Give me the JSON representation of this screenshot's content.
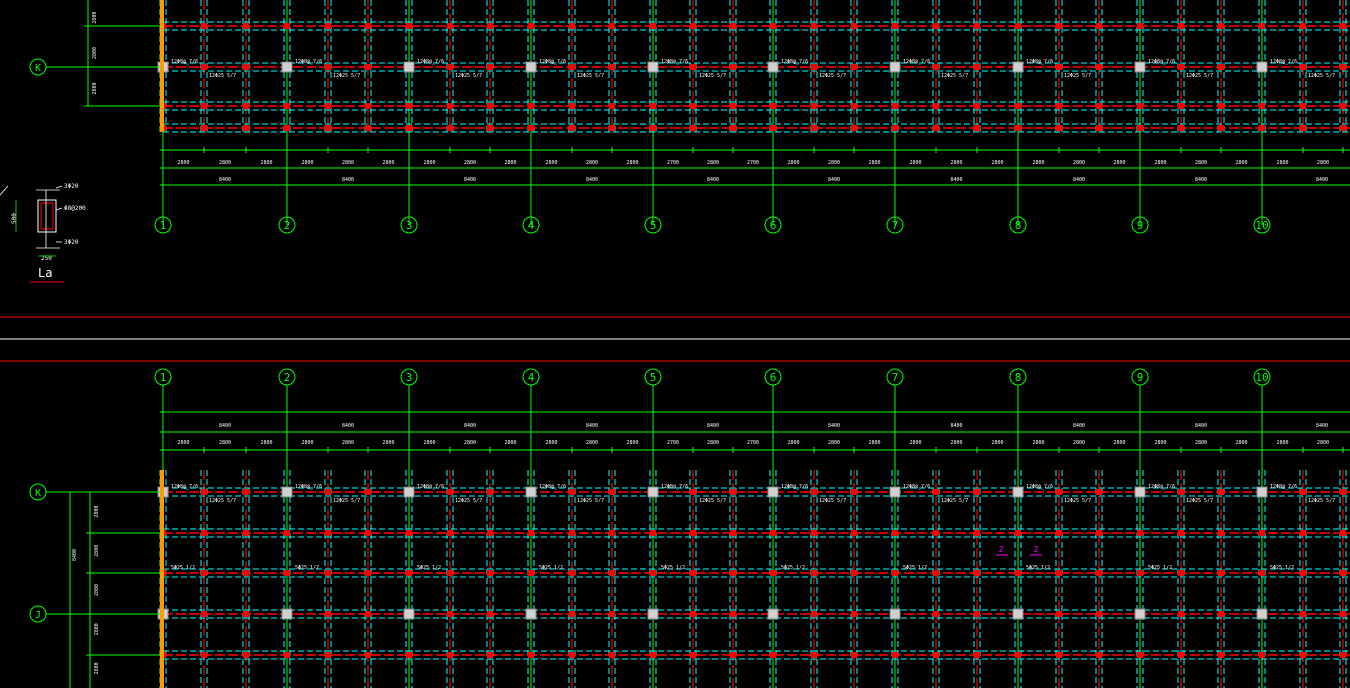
{
  "upper": {
    "grid_labels": [
      "1",
      "2",
      "3",
      "4",
      "5",
      "6",
      "7",
      "8",
      "9",
      "10"
    ],
    "row_labels": [
      "K"
    ],
    "bay_dims": [
      "8400",
      "8400",
      "8400",
      "8400",
      "8400",
      "8400",
      "8400",
      "8400",
      "8400",
      "8400"
    ],
    "sub_dims": [
      "2800",
      "2800",
      "2800",
      "2800",
      "2800",
      "2800",
      "2800",
      "2800",
      "2800",
      "2800",
      "2800",
      "2800",
      "2700",
      "2800",
      "2700",
      "2800",
      "2800",
      "2800",
      "2800",
      "2800",
      "2800",
      "2800",
      "2800",
      "2800",
      "2800",
      "2800",
      "2800",
      "2800",
      "2800",
      "2800",
      "2800",
      "2800"
    ],
    "row_dims": [
      "2800",
      "2800",
      "2800"
    ],
    "beam_label_top": "12Φ8@_7/6",
    "beam_label_bot": "12Φ25 5/7"
  },
  "lower": {
    "grid_labels": [
      "1",
      "2",
      "3",
      "4",
      "5",
      "6",
      "7",
      "8",
      "9",
      "10"
    ],
    "row_labels": [
      "K",
      "J"
    ],
    "bay_dims": [
      "8400",
      "8400",
      "8400",
      "8400",
      "8400",
      "8400",
      "8400",
      "8400",
      "8400",
      "8400"
    ],
    "sub_dims": [
      "2800",
      "2800",
      "2800",
      "2800",
      "2800",
      "2800",
      "2800",
      "2800",
      "2800",
      "2800",
      "2800",
      "2800",
      "2700",
      "2800",
      "2700",
      "2800",
      "2800",
      "2800",
      "2800",
      "2800",
      "2800",
      "2800",
      "2800",
      "2800",
      "2800",
      "2800",
      "2800",
      "2800",
      "2800",
      "2800",
      "2800",
      "2800"
    ],
    "row_dims": [
      "2800",
      "2800",
      "2800",
      "2800",
      "2800"
    ],
    "row_total": "8400",
    "beam_label_top": "12Φ8@_7/6",
    "beam_label_bot": "12Φ25 5/7",
    "mid_label": "5Φ25 1/2",
    "marker_a": "2",
    "marker_b": "2"
  },
  "section": {
    "title": "La",
    "top_bars": "3Φ20",
    "stirrups": "Φ8@200",
    "bottom_bars": "3Φ20",
    "height": "500",
    "width": "250"
  },
  "colors": {
    "background": "#000000",
    "grid": "#00ff00",
    "beam": "#ff0000",
    "dashed": "#00ffff",
    "column": "#d0d0d0",
    "wall": "#ff9a00",
    "text": "#ffffff",
    "marker": "#ff00ff"
  }
}
